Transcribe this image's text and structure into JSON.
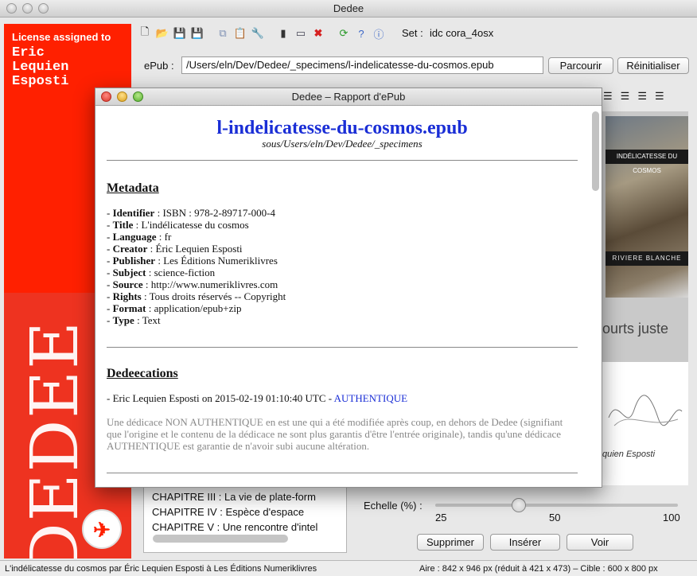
{
  "window": {
    "title": "Dedee"
  },
  "license": {
    "label": "License assigned to",
    "name_lines": [
      "Eric",
      "Lequien",
      "Esposti"
    ],
    "brand": "DEDEE"
  },
  "toolbar": {
    "set_label": "Set :",
    "set_value": "idc cora_4osx"
  },
  "epub": {
    "label": "ePub :",
    "path": "/Users/eln/Dev/Dedee/_specimens/l-indelicatesse-du-cosmos.epub",
    "browse_button": "Parcourir",
    "reset_button": "Réinitialiser"
  },
  "cover": {
    "title_band": "INDÉLICATESSE DU COSMOS",
    "collection_band": "RIVIERE BLANCHE",
    "caption": "ourts juste",
    "signature_name": "quien Esposti"
  },
  "chapters": [
    "CHAPITRE III : La vie de plate-form",
    "CHAPITRE IV : Espèce d'espace",
    "CHAPITRE V : Une rencontre d'intel"
  ],
  "scale": {
    "label": "Echelle (%) :",
    "min": "25",
    "mid": "50",
    "max": "100",
    "value_fraction": 0.33
  },
  "actions": {
    "delete": "Supprimer",
    "insert": "Insérer",
    "view": "Voir"
  },
  "status": {
    "left": "L'indélicatesse du cosmos par Éric Lequien Esposti à Les Éditions Numeriklivres",
    "right": "Aire : 842 x 946 px (réduit à 421 x 473) – Cible : 600 x 800 px"
  },
  "dialog": {
    "title": "Dedee – Rapport d'ePub",
    "doc_title": "l-indelicatesse-du-cosmos.epub",
    "doc_subtitle": "sous/Users/eln/Dev/Dedee/_specimens",
    "metadata_heading": "Metadata",
    "metadata": [
      {
        "key": "Identifier",
        "value": "ISBN : 978-2-89717-000-4"
      },
      {
        "key": "Title",
        "value": "L'indélicatesse du cosmos"
      },
      {
        "key": "Language",
        "value": "fr"
      },
      {
        "key": "Creator",
        "value": "Éric Lequien Esposti"
      },
      {
        "key": "Publisher",
        "value": "Les Éditions Numeriklivres"
      },
      {
        "key": "Subject",
        "value": "science-fiction"
      },
      {
        "key": "Source",
        "value": "http://www.numeriklivres.com"
      },
      {
        "key": "Rights",
        "value": "Tous droits réservés -- Copyright"
      },
      {
        "key": "Format",
        "value": "application/epub+zip"
      },
      {
        "key": "Type",
        "value": "Text"
      }
    ],
    "dedications_heading": "Dedeecations",
    "dedication_entry": "- Eric Lequien Esposti on 2015-02-19 01:10:40 UTC - ",
    "dedication_status": "AUTHENTIQUE",
    "note": "Une dédicace NON AUTHENTIQUE en est une qui a été modifiée après coup, en dehors de Dedee (signifiant que l'origine et le contenu de la dédicace ne sont plus garantis d'être l'entrée originale), tandis qu'une dédicace AUTHENTIQUE est garantie de n'avoir subi aucune altération."
  },
  "colors": {
    "brand_red": "#ff2000",
    "link_blue": "#1a2ed6"
  }
}
